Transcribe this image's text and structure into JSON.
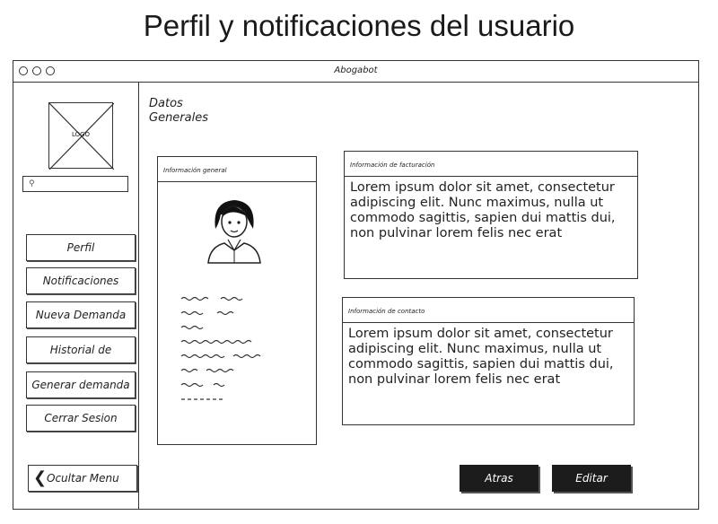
{
  "slide": {
    "title": "Perfil y notificaciones del usuario"
  },
  "window": {
    "title": "Abogabot"
  },
  "sidebar": {
    "logo_text": "LOGO",
    "nav_items": [
      {
        "label": "Perfil"
      },
      {
        "label": "Notificaciones"
      },
      {
        "label": "Nueva Demanda"
      },
      {
        "label": "Historial de"
      },
      {
        "label": "Generar demanda"
      },
      {
        "label": "Cerrar Sesion"
      }
    ],
    "hide_menu_label": "Ocultar Menu"
  },
  "main": {
    "section_title": "Datos Generales",
    "general_panel": {
      "header": "Información general"
    },
    "billing_panel": {
      "header": "Información de facturación",
      "body": "Lorem ipsum dolor sit amet, consectetur adipiscing elit. Nunc maximus, nulla ut commodo sagittis, sapien dui mattis dui, non pulvinar lorem felis nec erat"
    },
    "contact_panel": {
      "header": "Información de contacto",
      "body": "Lorem ipsum dolor sit amet, consectetur adipiscing elit. Nunc maximus, nulla ut commodo sagittis, sapien dui mattis dui, non pulvinar lorem felis nec erat"
    },
    "buttons": {
      "back": "Atras",
      "edit": "Editar"
    }
  },
  "icons": [
    "window-dot-icon",
    "logo-placeholder-icon",
    "search-icon",
    "user-avatar-icon",
    "chevron-left-icon"
  ],
  "colors": {
    "button_bg": "#1c1c1c",
    "button_text": "#ffffff",
    "border": "#333333"
  }
}
